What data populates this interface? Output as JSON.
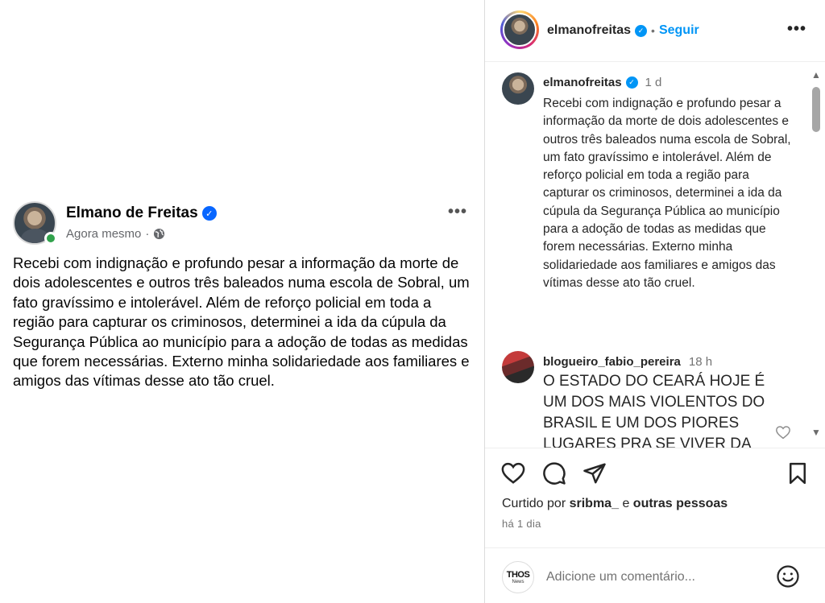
{
  "facebook_post": {
    "author_name": "Elmano de Freitas",
    "timestamp": "Agora mesmo",
    "separator": "·",
    "more_icon": "•••",
    "text": "Recebi com indignação e profundo pesar a informação da morte de dois adolescentes e outros três baleados numa escola de Sobral, um fato gravíssimo e intolerável. Além de reforço policial em toda a região para capturar os criminosos, determinei a ida da cúpula da Segurança Pública ao município para a adoção de todas as medidas que forem necessárias. Externo minha solidariedade aos familiares e amigos das vítimas desse ato tão cruel.",
    "verified_color": "#0866ff",
    "online_color": "#31a24c"
  },
  "instagram": {
    "header": {
      "username": "elmanofreitas",
      "dot": "•",
      "follow_label": "Seguir",
      "more_icon": "•••"
    },
    "caption": {
      "username": "elmanofreitas",
      "time": "1 d",
      "text": "Recebi com indignação e profundo pesar a informação da morte de dois adolescentes e outros três baleados numa escola de Sobral, um fato gravíssimo e intolerável. Além de reforço policial em toda a região para capturar os criminosos, determinei a ida da cúpula da Segurança Pública ao município para a adoção de todas as medidas que forem  necessárias. Externo minha solidariedade aos familiares e amigos das vítimas desse ato tão cruel."
    },
    "comment": {
      "username": "blogueiro_fabio_pereira",
      "time": "18 h",
      "text": "O ESTADO DO CEARÁ HOJE É UM DOS MAIS VIOLENTOS DO BRASIL E UM DOS PIORES LUGARES PRA SE VIVER DA"
    },
    "scroll_up": "▲",
    "scroll_down": "▼",
    "likes": {
      "prefix": "Curtido por",
      "user": "sribma_",
      "middle": "e",
      "others": "outras pessoas"
    },
    "posted_ago": "há 1 dia",
    "commenter_logo_line1": "THOS",
    "commenter_logo_line2": "News",
    "comment_placeholder": "Adicione um comentário...",
    "accent_color": "#0095f6"
  }
}
